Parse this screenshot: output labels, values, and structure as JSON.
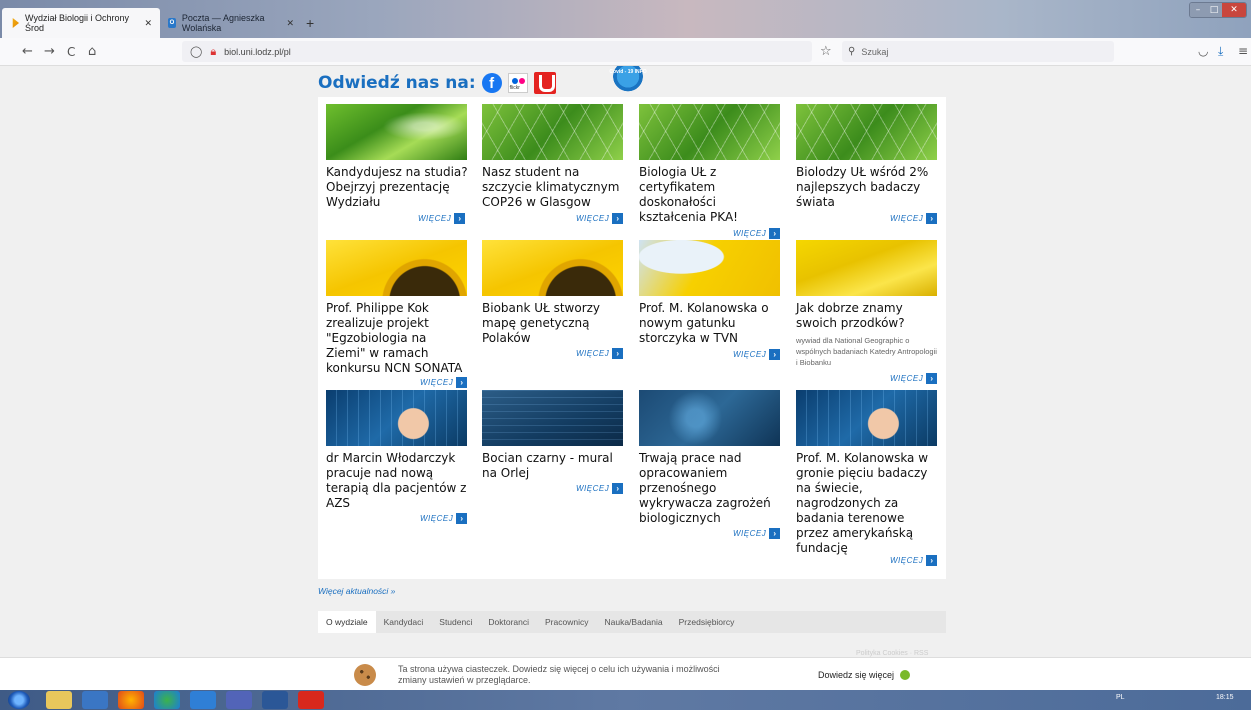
{
  "browser": {
    "tabs": [
      {
        "label": "Wydział Biologii i Ochrony Środ",
        "active": true
      },
      {
        "label": "Poczta — Agnieszka Wolańska",
        "active": false
      }
    ],
    "new_tab": "+",
    "url": "biol.uni.lodz.pl/pl",
    "search_placeholder": "Szukaj",
    "nav": {
      "back": "←",
      "forward": "→",
      "reload": "C",
      "home": "⌂"
    }
  },
  "header": {
    "visit_label": "Odwiedź nas na:",
    "flickr_label": "flickr",
    "covid_badge": "Covid - 19 INFO"
  },
  "news": [
    {
      "title": "Kandydujesz na studia? Obejrzyj prezentację Wydziału",
      "more": "WIĘCEJ",
      "image": "plant"
    },
    {
      "title": "Nasz student na szczycie klimatycznym COP26 w Glasgow",
      "more": "WIĘCEJ",
      "image": "hex"
    },
    {
      "title": "Biologia UŁ z certyfikatem doskonałości kształcenia PKA!",
      "more": "WIĘCEJ",
      "image": "hex"
    },
    {
      "title": "Biolodzy UŁ wśród 2% najlepszych badaczy świata",
      "more": "WIĘCEJ",
      "image": "hex"
    },
    {
      "title": "Prof. Philippe Kok zrealizuje projekt \"Egzobiologia na Ziemi\" w ramach konkursu NCN SONATA",
      "more": "WIĘCEJ",
      "image": "sunflower"
    },
    {
      "title": "Biobank UŁ stworzy mapę genetyczną Polaków",
      "more": "WIĘCEJ",
      "image": "sunflower"
    },
    {
      "title": "Prof. M. Kolanowska o nowym gatunku storczyka w TVN",
      "more": "WIĘCEJ",
      "image": "petal"
    },
    {
      "title": "Jak dobrze znamy swoich przodków?",
      "desc": "wywiad dla National Geographic o wspólnych badaniach Katedry Antropologii i Biobanku",
      "more": "WIĘCEJ",
      "image": "petal"
    },
    {
      "title": "dr Marcin Włodarczyk pracuje nad nową terapią dla pacjentów z AZS",
      "more": "WIĘCEJ",
      "image": "tech"
    },
    {
      "title": "Bocian czarny - mural na Orlej",
      "more": "WIĘCEJ",
      "image": "tech"
    },
    {
      "title": "Trwają prace nad opracowaniem przenośnego wykrywacza zagrożeń biologicznych",
      "more": "WIĘCEJ",
      "image": "tech"
    },
    {
      "title": "Prof. M. Kolanowska w gronie pięciu badaczy na świecie, nagrodzonych za badania terenowe przez amerykańską fundację",
      "more": "WIĘCEJ",
      "image": "tech"
    }
  ],
  "more_news": "Więcej aktualności »",
  "footer_nav": [
    "O wydziale",
    "Kandydaci",
    "Studenci",
    "Doktoranci",
    "Pracownicy",
    "Nauka/Badania",
    "Przedsiębiorcy"
  ],
  "cookie": {
    "text": "Ta strona używa ciasteczek. Dowiedz się więcej o celu ich używania i możliwości zmiany ustawień w przeglądarce.",
    "more": "Dowiedz się więcej",
    "behind": "Polityka Cookies · RSS"
  },
  "taskbar": {
    "lang": "PL",
    "time": "18:15"
  }
}
